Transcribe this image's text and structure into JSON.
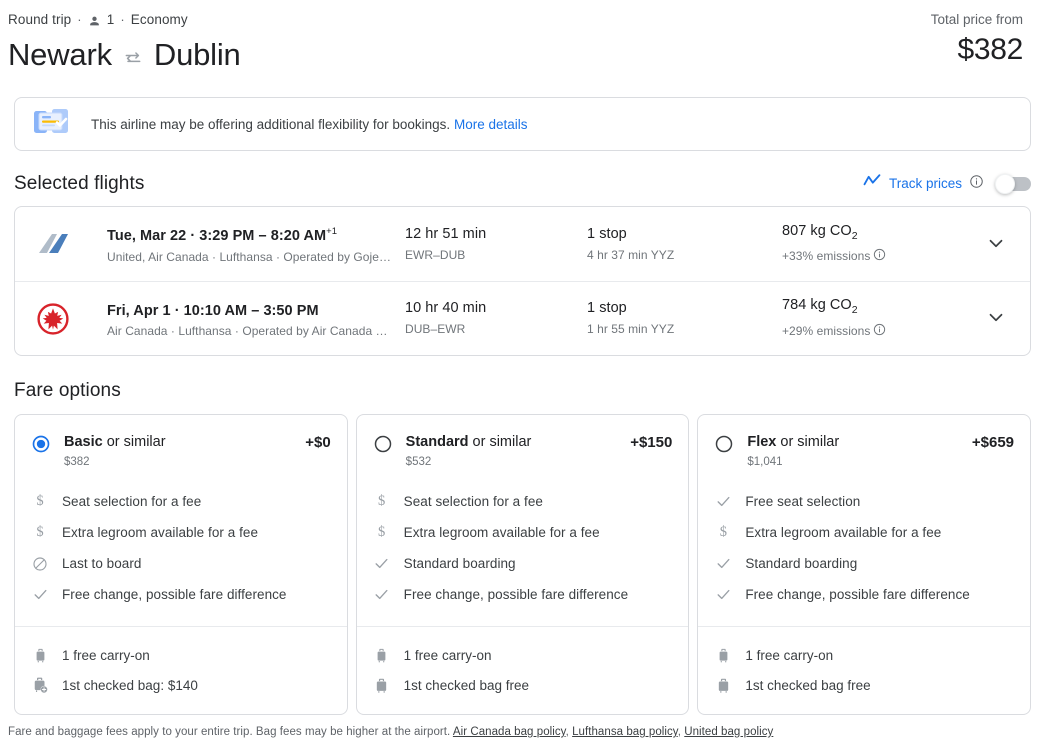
{
  "header": {
    "trip_type": "Round trip",
    "passengers": "1",
    "cabin": "Economy",
    "origin": "Newark",
    "destination": "Dublin",
    "total_price_label": "Total price from",
    "total_price": "$382"
  },
  "banner": {
    "text": "This airline may be offering additional flexibility for bookings.",
    "link": "More details"
  },
  "selected_flights": {
    "section_title": "Selected flights",
    "track_prices_label": "Track prices",
    "toggle_state": "off",
    "flights": [
      {
        "airline_logo": "united-logo",
        "date_times": "Tue, Mar 22  ·  3:29 PM – 8:20 AM",
        "next_day": "+1",
        "airlines": "United, Air Canada · Lufthansa · Operated by Goje…",
        "duration": "12 hr 51 min",
        "route": "EWR–DUB",
        "stops": "1 stop",
        "layover": "4 hr 37 min YYZ",
        "co2_amount": "807 kg CO",
        "co2_sub": "2",
        "emissions": "+33% emissions"
      },
      {
        "airline_logo": "air-canada-logo",
        "date_times": "Fri, Apr 1  ·  10:10 AM – 3:50 PM",
        "next_day": "",
        "airlines": "Air Canada · Lufthansa · Operated by Air Canada …",
        "duration": "10 hr 40 min",
        "route": "DUB–EWR",
        "stops": "1 stop",
        "layover": "1 hr 55 min YYZ",
        "co2_amount": "784 kg CO",
        "co2_sub": "2",
        "emissions": "+29% emissions"
      }
    ]
  },
  "fare_options": {
    "section_title": "Fare options",
    "cards": [
      {
        "name": "Basic",
        "suffix": " or similar",
        "price": "$382",
        "delta": "+$0",
        "selected": true,
        "features": [
          {
            "icon": "dollar-icon",
            "text": "Seat selection for a fee"
          },
          {
            "icon": "dollar-icon",
            "text": "Extra legroom available for a fee"
          },
          {
            "icon": "block-icon",
            "text": "Last to board"
          },
          {
            "icon": "check-icon",
            "text": "Free change, possible fare difference"
          }
        ],
        "baggage": [
          {
            "icon": "carry-on-icon",
            "text": "1 free carry-on"
          },
          {
            "icon": "checked-bag-fee-icon",
            "text": "1st checked bag: $140"
          }
        ]
      },
      {
        "name": "Standard",
        "suffix": " or similar",
        "price": "$532",
        "delta": "+$150",
        "selected": false,
        "features": [
          {
            "icon": "dollar-icon",
            "text": "Seat selection for a fee"
          },
          {
            "icon": "dollar-icon",
            "text": "Extra legroom available for a fee"
          },
          {
            "icon": "check-icon",
            "text": "Standard boarding"
          },
          {
            "icon": "check-icon",
            "text": "Free change, possible fare difference"
          }
        ],
        "baggage": [
          {
            "icon": "carry-on-icon",
            "text": "1 free carry-on"
          },
          {
            "icon": "checked-bag-icon",
            "text": "1st checked bag free"
          }
        ]
      },
      {
        "name": "Flex",
        "suffix": " or similar",
        "price": "$1,041",
        "delta": "+$659",
        "selected": false,
        "features": [
          {
            "icon": "check-icon",
            "text": "Free seat selection"
          },
          {
            "icon": "dollar-icon",
            "text": "Extra legroom available for a fee"
          },
          {
            "icon": "check-icon",
            "text": "Standard boarding"
          },
          {
            "icon": "check-icon",
            "text": "Free change, possible fare difference"
          }
        ],
        "baggage": [
          {
            "icon": "carry-on-icon",
            "text": "1 free carry-on"
          },
          {
            "icon": "checked-bag-icon",
            "text": "1st checked bag free"
          }
        ]
      }
    ]
  },
  "footer": {
    "text": "Fare and baggage fees apply to your entire trip. Bag fees may be higher at the airport.",
    "links": [
      "Air Canada bag policy",
      "Lufthansa bag policy",
      "United bag policy"
    ]
  },
  "colors": {
    "accent": "#1a73e8",
    "text_primary": "#202124",
    "text_secondary": "#5f6368",
    "border": "#dadce0",
    "air_canada_red": "#d8232a",
    "united_blue": "#4a7ebb"
  }
}
